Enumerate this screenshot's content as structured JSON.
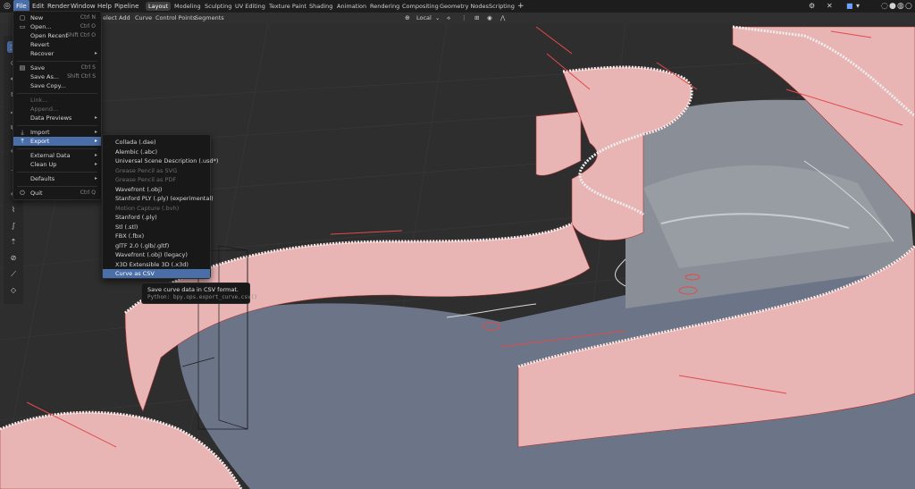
{
  "top_menu": {
    "file": "File",
    "edit": "Edit",
    "render": "Render",
    "window": "Window",
    "help": "Help",
    "pipeline": "Pipeline"
  },
  "workspaces": [
    "Layout",
    "Modeling",
    "Sculpting",
    "UV Editing",
    "Texture Paint",
    "Shading",
    "Animation",
    "Rendering",
    "Compositing",
    "Geometry Nodes",
    "Scripting"
  ],
  "add_workspace": "+",
  "header": {
    "select": "elect",
    "add": "Add",
    "curve": "Curve",
    "control_points": "Control Points",
    "segments": "Segments",
    "orientation": "Local"
  },
  "file_menu": {
    "new": "New",
    "new_sc": "Ctrl N",
    "open": "Open...",
    "open_sc": "Ctrl O",
    "open_recent": "Open Recent",
    "open_recent_sc": "Shift Ctrl O",
    "revert": "Revert",
    "recover": "Recover",
    "save": "Save",
    "save_sc": "Ctrl S",
    "save_as": "Save As...",
    "save_as_sc": "Shift Ctrl S",
    "save_copy": "Save Copy...",
    "link": "Link...",
    "append": "Append...",
    "data_previews": "Data Previews",
    "import": "Import",
    "export": "Export",
    "external_data": "External Data",
    "clean_up": "Clean Up",
    "defaults": "Defaults",
    "quit": "Quit",
    "quit_sc": "Ctrl Q"
  },
  "export_menu": [
    {
      "label": "Collada (.dae)",
      "enabled": true
    },
    {
      "label": "Alembic (.abc)",
      "enabled": true
    },
    {
      "label": "Universal Scene Description (.usd*)",
      "enabled": true
    },
    {
      "label": "Grease Pencil as SVG",
      "enabled": false
    },
    {
      "label": "Grease Pencil as PDF",
      "enabled": false
    },
    {
      "label": "Wavefront (.obj)",
      "enabled": true
    },
    {
      "label": "Stanford PLY (.ply) (experimental)",
      "enabled": true
    },
    {
      "label": "Motion Capture (.bvh)",
      "enabled": false
    },
    {
      "label": "Stanford (.ply)",
      "enabled": true
    },
    {
      "label": "Stl (.stl)",
      "enabled": true
    },
    {
      "label": "FBX (.fbx)",
      "enabled": true
    },
    {
      "label": "glTF 2.0 (.glb/.gltf)",
      "enabled": true
    },
    {
      "label": "Wavefront (.obj) (legacy)",
      "enabled": true
    },
    {
      "label": "X3D Extensible 3D (.x3d)",
      "enabled": true
    },
    {
      "label": "Curve as CSV",
      "enabled": true,
      "highlighted": true
    }
  ],
  "tooltip": {
    "title": "Save curve data in CSV format.",
    "python": "Python: bpy.ops.export_curve.csv()"
  },
  "colors": {
    "accent": "#4a6ea8",
    "menu_bg": "#181818",
    "curve_red": "#e24a4a",
    "floor": "#6a7486"
  }
}
